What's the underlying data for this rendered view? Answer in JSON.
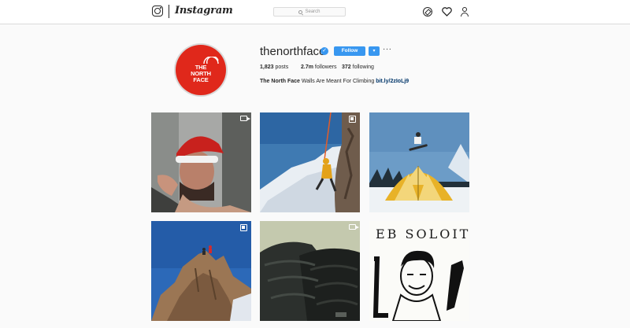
{
  "nav": {
    "wordmark": "Instagram",
    "search_placeholder": "Search",
    "icons": [
      "instagram-glyph-icon",
      "compass-icon",
      "heart-icon",
      "profile-icon"
    ]
  },
  "profile": {
    "avatar_logo": [
      "THE",
      "NORTH",
      "FACE"
    ],
    "username": "thenorthface",
    "verified": true,
    "follow_label": "Follow",
    "more_label": "···",
    "stats": {
      "posts_count": "1,823",
      "posts_label": "posts",
      "followers_count": "2.7m",
      "followers_label": "followers",
      "following_count": "372",
      "following_label": "following"
    },
    "bio_name": "The North Face",
    "bio_text": "Walls Are Meant For Climbing",
    "bio_link": "bit.ly/2zIoLj9"
  },
  "posts": [
    {
      "subject": "Climber in Santa hat",
      "badge": "video"
    },
    {
      "subject": "Climber on ice wall",
      "badge": "multi"
    },
    {
      "subject": "Snowboarder over dome tent",
      "badge": "none"
    },
    {
      "subject": "Climbers on rock summit",
      "badge": "multi"
    },
    {
      "subject": "Black puffer jackets",
      "badge": "video"
    },
    {
      "subject": "Sketch of climber",
      "badge": "none",
      "caption": "EB SOLOIT"
    }
  ],
  "colors": {
    "brand_red": "#e0281b",
    "follow_blue": "#3897f0",
    "link_blue": "#003569"
  }
}
